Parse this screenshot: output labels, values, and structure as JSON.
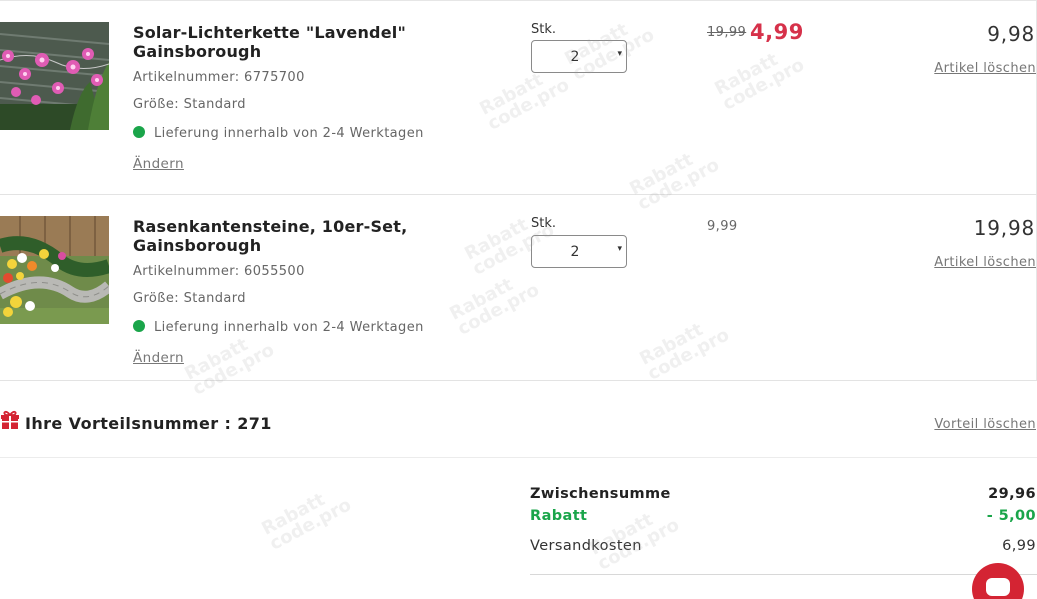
{
  "items": [
    {
      "title": "Solar-Lichterkette \"Lavendel\" Gainsborough",
      "article": "Artikelnummer: 6775700",
      "size": "Größe: Standard",
      "delivery": "Lieferung innerhalb von 2-4 Werktagen",
      "change_label": "Ändern",
      "qty_label": "Stk.",
      "qty": "2",
      "old_price": "19,99",
      "price": "4,99",
      "total": "9,98",
      "delete_label": "Artikel löschen"
    },
    {
      "title": "Rasenkantensteine, 10er-Set, Gainsborough",
      "article": "Artikelnummer: 6055500",
      "size": "Größe: Standard",
      "delivery": "Lieferung innerhalb von 2-4 Werktagen",
      "change_label": "Ändern",
      "qty_label": "Stk.",
      "qty": "2",
      "price": "9,99",
      "total": "19,98",
      "delete_label": "Artikel löschen"
    }
  ],
  "promo": {
    "text": "Ihre Vorteilsnummer : 271",
    "delete_label": "Vorteil löschen"
  },
  "summary": {
    "subtotal_label": "Zwischensumme",
    "subtotal": "29,96",
    "discount_label": "Rabatt",
    "discount": "- 5,00",
    "shipping_label": "Versandkosten",
    "shipping": "6,99"
  },
  "watermark": {
    "line1": "Rabatt",
    "line2": "code",
    "line3": ".pro"
  },
  "colors": {
    "sale": "#d6314a",
    "discount": "#1aa54a",
    "availability": "#1aa54a",
    "chat": "#d42433"
  },
  "icons": {
    "promo": "gift-icon",
    "chat": "chat-icon",
    "availability": "availability-dot-icon"
  }
}
